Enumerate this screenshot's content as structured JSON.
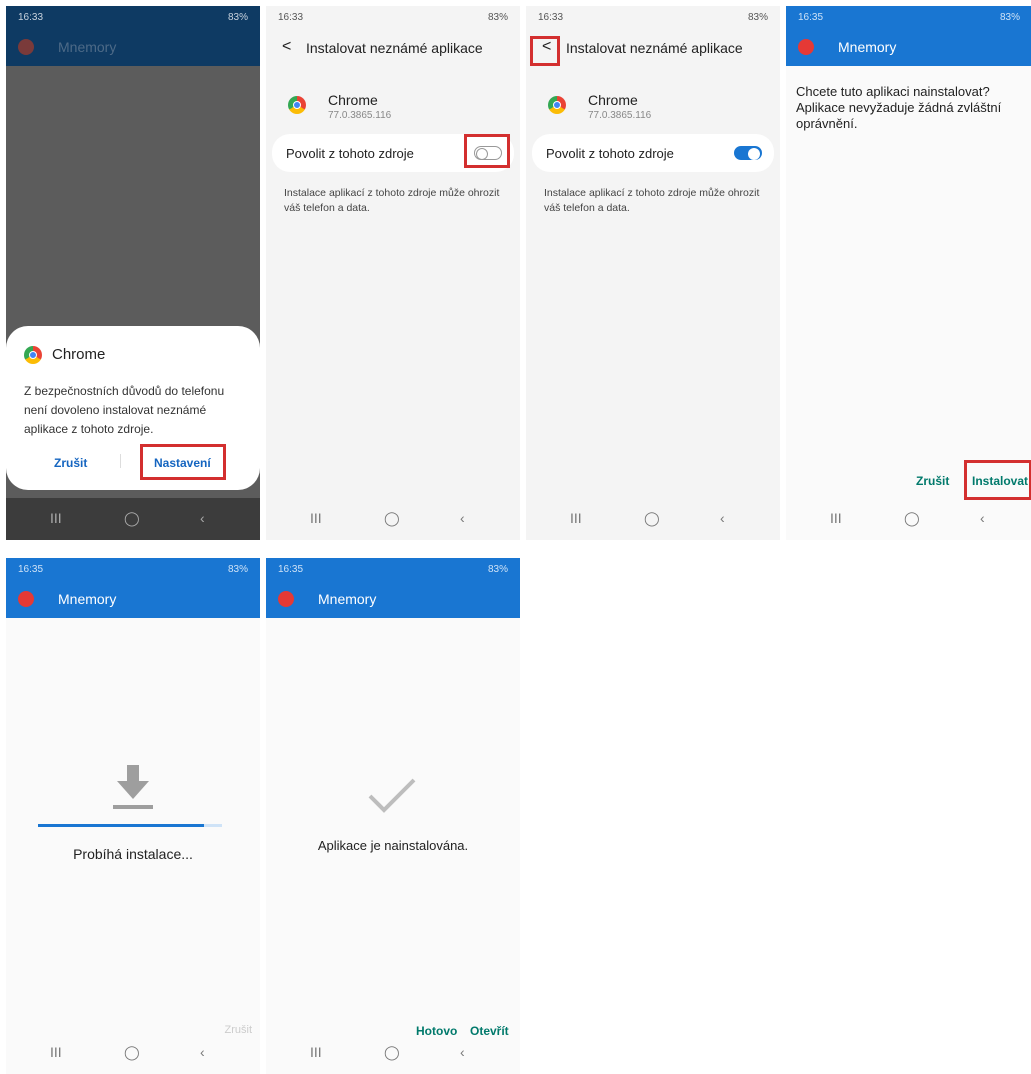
{
  "status": {
    "s1": {
      "time": "16:33",
      "right": "83%"
    },
    "s2": {
      "time": "16:33",
      "right": "83%"
    },
    "s3": {
      "time": "16:33",
      "right": "83%"
    },
    "s4": {
      "time": "16:35",
      "right": "83%"
    },
    "s5": {
      "time": "16:35",
      "right": "83%"
    },
    "s6": {
      "time": "16:35",
      "right": "83%"
    }
  },
  "nav": {
    "recents": "III",
    "home": "◯",
    "back": "‹"
  },
  "app_name": "Mnemory",
  "screen1": {
    "dialog_app": "Chrome",
    "dialog_text": "Z bezpečnostních důvodů do telefonu není dovoleno instalovat neznámé aplikace z tohoto zdroje.",
    "cancel": "Zrušit",
    "settings": "Nastavení"
  },
  "settings_screen": {
    "back_glyph": "<",
    "header": "Instalovat neznámé aplikace",
    "app": "Chrome",
    "version": "77.0.3865.116",
    "toggle_label": "Povolit z tohoto zdroje",
    "warning": "Instalace aplikací z tohoto zdroje může ohrozit váš telefon a data."
  },
  "toggles": {
    "screen2": false,
    "screen3": true
  },
  "screen4": {
    "question": "Chcete tuto aplikaci nainstalovat? Aplikace nevyžaduje žádná zvláštní oprávnění.",
    "cancel": "Zrušit",
    "install": "Instalovat"
  },
  "screen5": {
    "status": "Probíhá instalace...",
    "cancel": "Zrušit",
    "progress": 0.9
  },
  "screen6": {
    "status": "Aplikace je nainstalována.",
    "done": "Hotovo",
    "open": "Otevřít"
  },
  "colors": {
    "accent": "#1976d2",
    "highlight": "#d32f2f",
    "button_text": "#00796b",
    "dialog_link": "#1565c0"
  }
}
